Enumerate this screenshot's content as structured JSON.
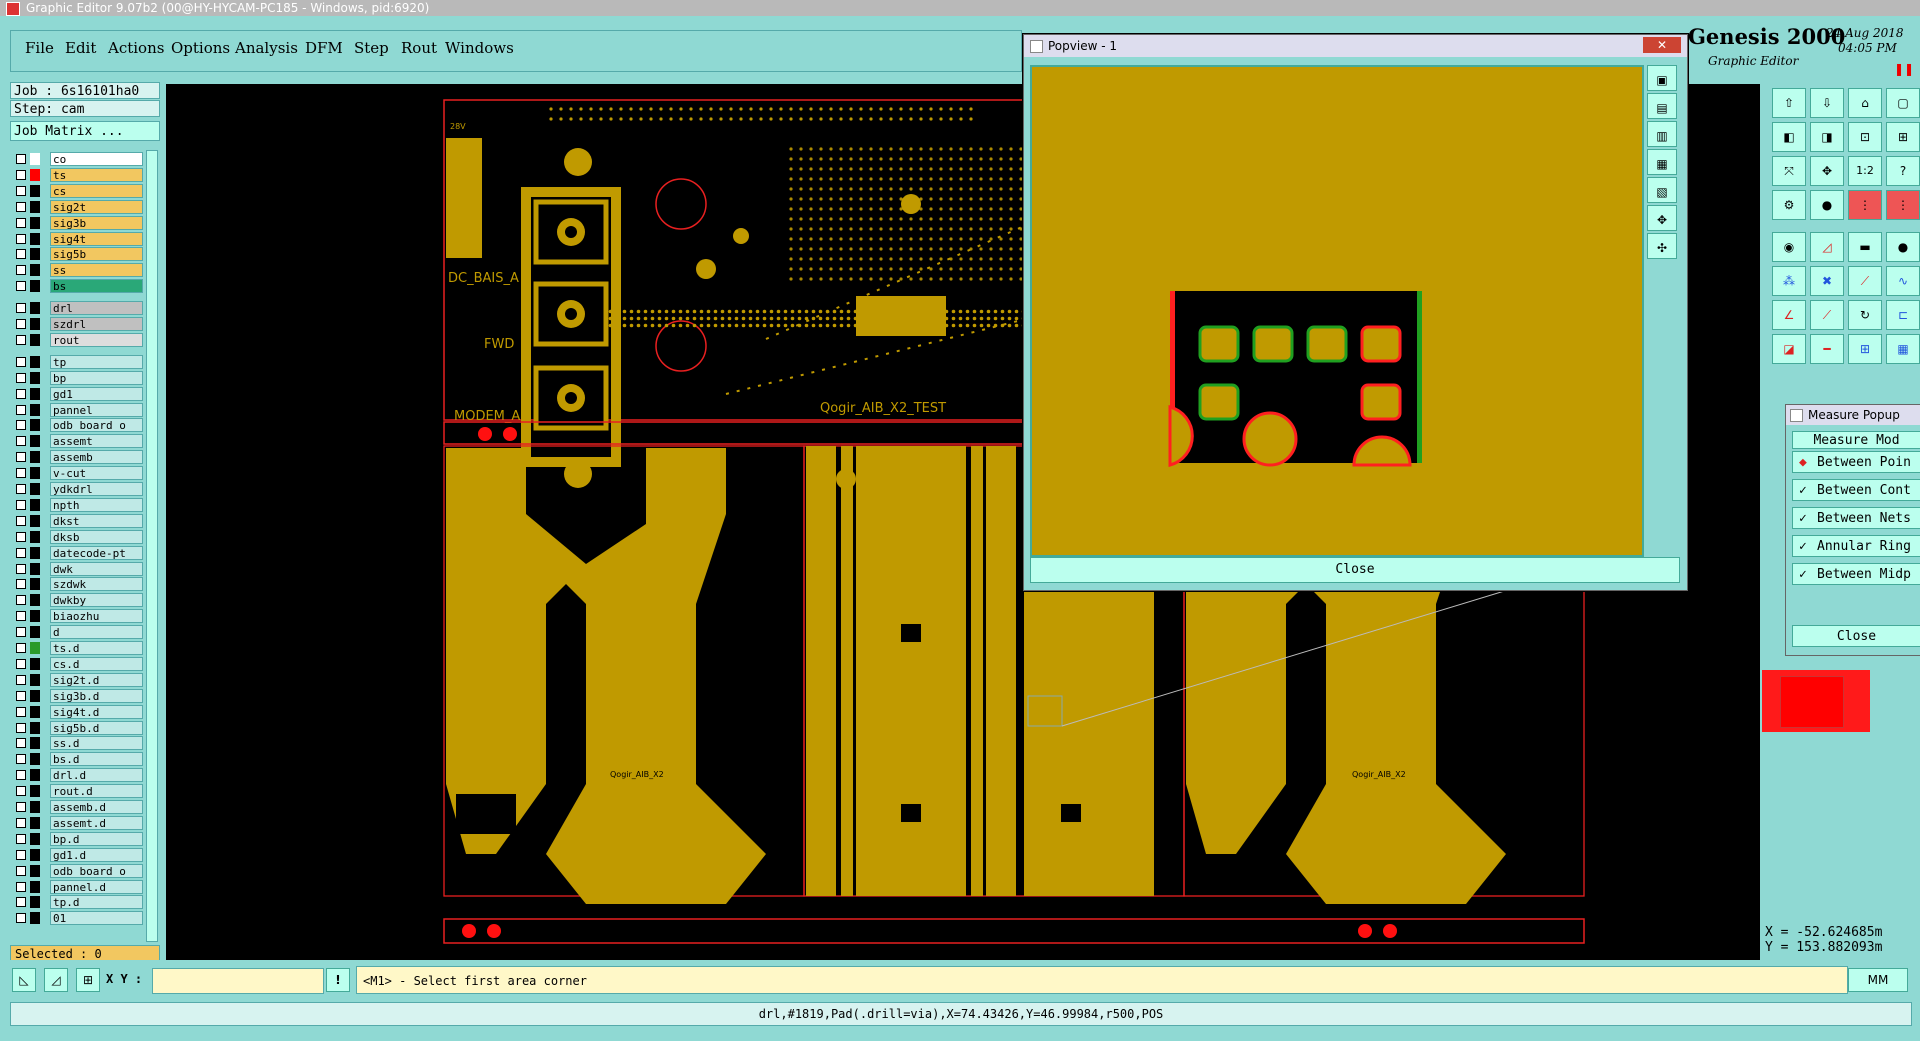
{
  "window": {
    "title": "Graphic Editor 9.07b2 (00@HY-HYCAM-PC185 - Windows, pid:6920)"
  },
  "menu": {
    "items": [
      "File",
      "Edit",
      "Actions",
      "Options",
      "Analysis",
      "DFM",
      "Step",
      "Rout",
      "Windows"
    ]
  },
  "job": {
    "job_label": "Job : 6s16101ha0",
    "step_label": "Step: cam",
    "matrix_button": "Job Matrix ..."
  },
  "layers": [
    {
      "name": "co",
      "color": "#ffffff",
      "swatch": "#ffffff"
    },
    {
      "name": "ts",
      "color": "#f2c760",
      "swatch": "#ff0000"
    },
    {
      "name": "cs",
      "color": "#f2c760",
      "swatch": "#000000"
    },
    {
      "name": "sig2t",
      "color": "#f2c760",
      "swatch": "#000000"
    },
    {
      "name": "sig3b",
      "color": "#f2c760",
      "swatch": "#000000"
    },
    {
      "name": "sig4t",
      "color": "#f2c760",
      "swatch": "#000000"
    },
    {
      "name": "sig5b",
      "color": "#f2c760",
      "swatch": "#000000"
    },
    {
      "name": "ss",
      "color": "#f2c760",
      "swatch": "#000000"
    },
    {
      "name": "bs",
      "color": "#2aa878",
      "swatch": "#000000"
    },
    {
      "name": "drl",
      "color": "#c0c0c0",
      "swatch": "#000000"
    },
    {
      "name": "szdrl",
      "color": "#c0c0c0",
      "swatch": "#000000"
    },
    {
      "name": "rout",
      "color": "#dddddd",
      "swatch": "#000000"
    },
    {
      "name": "tp",
      "color": "#bfe9e6",
      "swatch": "#000000"
    },
    {
      "name": "bp",
      "color": "#bfe9e6",
      "swatch": "#000000"
    },
    {
      "name": "gd1",
      "color": "#bfe9e6",
      "swatch": "#000000"
    },
    {
      "name": "pannel",
      "color": "#bfe9e6",
      "swatch": "#000000"
    },
    {
      "name": "odb_board_o",
      "color": "#bfe9e6",
      "swatch": "#000000"
    },
    {
      "name": "assemt",
      "color": "#bfe9e6",
      "swatch": "#000000"
    },
    {
      "name": "assemb",
      "color": "#bfe9e6",
      "swatch": "#000000"
    },
    {
      "name": "v-cut",
      "color": "#bfe9e6",
      "swatch": "#000000"
    },
    {
      "name": "ydkdrl",
      "color": "#bfe9e6",
      "swatch": "#000000"
    },
    {
      "name": "npth",
      "color": "#bfe9e6",
      "swatch": "#000000"
    },
    {
      "name": "dkst",
      "color": "#bfe9e6",
      "swatch": "#000000"
    },
    {
      "name": "dksb",
      "color": "#bfe9e6",
      "swatch": "#000000"
    },
    {
      "name": "datecode-pt",
      "color": "#bfe9e6",
      "swatch": "#000000"
    },
    {
      "name": "dwk",
      "color": "#bfe9e6",
      "swatch": "#000000"
    },
    {
      "name": "szdwk",
      "color": "#bfe9e6",
      "swatch": "#000000"
    },
    {
      "name": "dwkby",
      "color": "#bfe9e6",
      "swatch": "#000000"
    },
    {
      "name": "biaozhu",
      "color": "#bfe9e6",
      "swatch": "#000000"
    },
    {
      "name": "d",
      "color": "#bfe9e6",
      "swatch": "#000000"
    },
    {
      "name": "ts.d",
      "color": "#bfe9e6",
      "swatch": "#2a9a2a"
    },
    {
      "name": "cs.d",
      "color": "#bfe9e6",
      "swatch": "#000000"
    },
    {
      "name": "sig2t.d",
      "color": "#bfe9e6",
      "swatch": "#000000"
    },
    {
      "name": "sig3b.d",
      "color": "#bfe9e6",
      "swatch": "#000000"
    },
    {
      "name": "sig4t.d",
      "color": "#bfe9e6",
      "swatch": "#000000"
    },
    {
      "name": "sig5b.d",
      "color": "#bfe9e6",
      "swatch": "#000000"
    },
    {
      "name": "ss.d",
      "color": "#bfe9e6",
      "swatch": "#000000"
    },
    {
      "name": "bs.d",
      "color": "#bfe9e6",
      "swatch": "#000000"
    },
    {
      "name": "drl.d",
      "color": "#bfe9e6",
      "swatch": "#000000"
    },
    {
      "name": "rout.d",
      "color": "#bfe9e6",
      "swatch": "#000000"
    },
    {
      "name": "assemb.d",
      "color": "#bfe9e6",
      "swatch": "#000000"
    },
    {
      "name": "assemt.d",
      "color": "#bfe9e6",
      "swatch": "#000000"
    },
    {
      "name": "bp.d",
      "color": "#bfe9e6",
      "swatch": "#000000"
    },
    {
      "name": "gd1.d",
      "color": "#bfe9e6",
      "swatch": "#000000"
    },
    {
      "name": "odb_board_o",
      "color": "#bfe9e6",
      "swatch": "#000000"
    },
    {
      "name": "pannel.d",
      "color": "#bfe9e6",
      "swatch": "#000000"
    },
    {
      "name": "tp.d",
      "color": "#bfe9e6",
      "swatch": "#000000"
    },
    {
      "name": "01",
      "color": "#bfe9e6",
      "swatch": "#000000"
    }
  ],
  "selected": {
    "label": "Selected : 0"
  },
  "board": {
    "labels": [
      "DC_BAIS_A",
      "FWD",
      "MODEM_A",
      "Qogir_AIB_X2_TEST",
      "28V",
      "Qogir_AIB_X2",
      "Qogir_AIB_X2"
    ]
  },
  "popview": {
    "title": "Popview - 1",
    "close_label": "Close"
  },
  "genesis": {
    "brand": "Genesis 2000",
    "subtitle": "Graphic Editor",
    "date": "24 Aug 2018",
    "time": "04:05 PM"
  },
  "measure": {
    "title": "Measure Popup",
    "header": "Measure Mod",
    "items": [
      "Between Poin",
      "Between Cont",
      "Between Nets",
      "Annular Ring",
      "Between Midp"
    ],
    "close_label": "Close"
  },
  "coords": {
    "x": "X = -52.624685m",
    "y": "Y = 153.882093m"
  },
  "bottom": {
    "xy_label": "X Y :",
    "xy_value": "",
    "command": "<M1> - Select first area corner",
    "units": "MM",
    "status": "drl,#1819,Pad(.drill=via),X=74.43426,Y=46.99984,r500,POS"
  },
  "colors": {
    "panel": "#8fd9d3",
    "copper": "#c09a00",
    "outline": "#e82020",
    "accent_red": "#ff0000"
  }
}
